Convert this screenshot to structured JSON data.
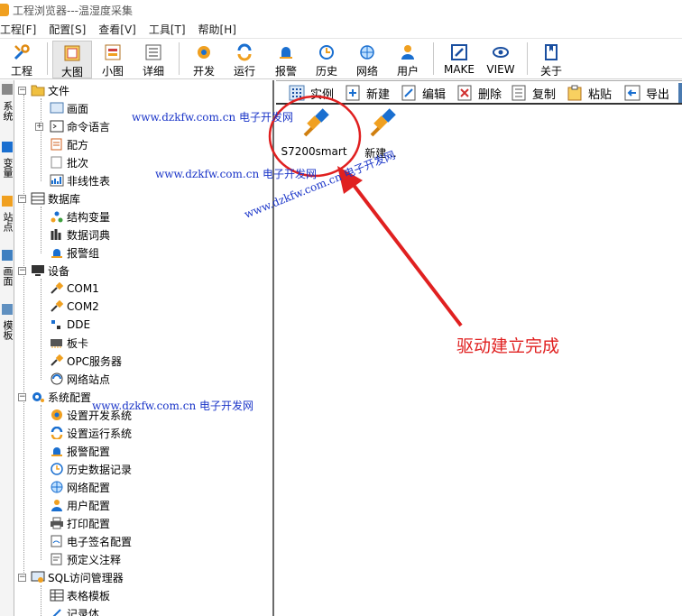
{
  "window": {
    "title": "工程浏览器---温湿度采集"
  },
  "menubar": {
    "items": [
      "工程[F]",
      "配置[S]",
      "查看[V]",
      "工具[T]",
      "帮助[H]"
    ]
  },
  "toolbar": {
    "items": [
      {
        "label": "工程",
        "icon": "tools-icon"
      },
      {
        "label": "大图",
        "icon": "large-icons-icon"
      },
      {
        "label": "小图",
        "icon": "small-icons-icon"
      },
      {
        "label": "详细",
        "icon": "details-icon"
      },
      {
        "label": "开发",
        "icon": "develop-icon"
      },
      {
        "label": "运行",
        "icon": "run-icon"
      },
      {
        "label": "报警",
        "icon": "alarm-icon"
      },
      {
        "label": "历史",
        "icon": "history-icon"
      },
      {
        "label": "网络",
        "icon": "network-icon"
      },
      {
        "label": "用户",
        "icon": "user-icon"
      },
      {
        "label": "MAKE",
        "icon": "make-icon"
      },
      {
        "label": "VIEW",
        "icon": "view-icon"
      },
      {
        "label": "关于",
        "icon": "about-icon"
      }
    ]
  },
  "lefttabs": [
    "系统",
    "变量",
    "站点",
    "画面",
    "模板"
  ],
  "tree": {
    "file": {
      "label": "文件",
      "children": [
        "画面",
        "命令语言",
        "配方",
        "批次",
        "非线性表"
      ]
    },
    "database": {
      "label": "数据库",
      "children": [
        "结构变量",
        "数据词典",
        "报警组"
      ]
    },
    "device": {
      "label": "设备",
      "children": [
        "COM1",
        "COM2",
        "DDE",
        "板卡",
        "OPC服务器",
        "网络站点"
      ]
    },
    "sysconfig": {
      "label": "系统配置",
      "children": [
        "设置开发系统",
        "设置运行系统",
        "报警配置",
        "历史数据记录",
        "网络配置",
        "用户配置",
        "打印配置",
        "电子签名配置",
        "预定义注释"
      ]
    },
    "sql": {
      "label": "SQL访问管理器",
      "children": [
        "表格模板",
        "记录体"
      ]
    }
  },
  "right_toolbar": [
    "实例",
    "新建",
    "编辑",
    "删除",
    "复制",
    "粘贴",
    "导出"
  ],
  "devices": [
    {
      "label": "S7200smart"
    },
    {
      "label": "新建..."
    }
  ],
  "watermarks": {
    "text1": "www.dzkfw.com.cn 电子开发网",
    "text2": "www.dzkfw.com.cn 电子开发网",
    "text3": "www.dzkfw.com.cn 电子开发网",
    "text4": "www.dzkfw.com.cn 电子开发网"
  },
  "annotation": {
    "text": "驱动建立完成",
    "color": "#e02020"
  }
}
